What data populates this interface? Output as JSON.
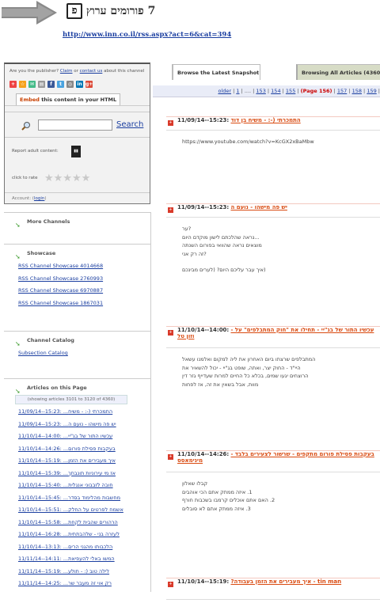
{
  "header": {
    "title": "7 פורומים ערוץ",
    "feed_url": "http://www.inn.co.il/rss.aspx?act=6&cat=394"
  },
  "panel": {
    "publisher_text": "Are you the publisher?",
    "claim": "Claim",
    "or": "or",
    "contact_us": "contact us",
    "about": "about this channel",
    "embed_prefix": "Embed",
    "embed_rest": " this content in your HTML",
    "search_button": "Search",
    "search_value": "",
    "report_label": "Report adult content:",
    "rate_label": "click to rate",
    "account_label": "Account:",
    "login": "login"
  },
  "more_channels": {
    "title": "More Channels"
  },
  "showcase": {
    "title": "Showcase",
    "items": [
      "RSS Channel Showcase 4014668",
      "RSS Channel Showcase 2760993",
      "RSS Channel Showcase 6970887",
      "RSS Channel Showcase 1867031"
    ]
  },
  "catalog": {
    "title": "Channel Catalog",
    "items": [
      "Subsection Catalog"
    ]
  },
  "articles_list": {
    "title": "Articles on this Page",
    "showing": "(showing articles 3101 to 3120 of 4360)",
    "items": [
      "11/09/14--15:23: ...התמכרתי (-: - משיח",
      "11/09/14--15:23: ...יש פה מישהו - נועם ה",
      "11/10/14--14:00: ...עכשיו התור של בג\"יי",
      "11/10/14--14:26: ...בעקבות פסילת פורום",
      "11/10/14--15:19: ...איך מעבירים את הזמן",
      "11/10/14--15:39: ...אז מי עירוניות תונבתך",
      "11/10/14--15:40: ...חובה לזבבוני אנגלית",
      "11/10/14--15:45: ...מחשבות מהלימוד בסדר",
      "11/10/14--15:51: ...אשמח לפרטים על החלק",
      "11/10/14--15:58: ...הרהורים שהבית לקחת",
      "11/10/14--16:28: ...לעזרה בני - שלהבתתית",
      "11/10/14--13:13: ...הלכבותו מהגני הרים",
      "11/11/14--14:11: ...המשו באלי להעפיאת",
      "11/11/14--15:19: ...לילה טוב (: - תולע",
      "11/11/14--14:25: ...רק אוי זה מעבר שר"
    ]
  },
  "tabs": {
    "latest": "Browse the Latest Snapshot",
    "all": "Browsing All Articles (4360 Articles)"
  },
  "pager": {
    "older": "older",
    "first": "1",
    "ellipsis": "....",
    "p153": "153",
    "p154": "154",
    "p155": "155",
    "current": "(Page 156)",
    "p157": "157",
    "p158": "158",
    "p159": "159"
  },
  "articles": [
    {
      "date": "11/09/14--15:23:",
      "title": "התמכרתי (-: - משיח בן דוד",
      "body": [
        "https://www.youtube.com/watch?v=KcGX2xBaMbw"
      ]
    },
    {
      "date": "11/09/14--15:23:",
      "title": "יש פה מישהו - נועם ה",
      "body": [
        "?ער",
        "...נראה שהלכתם לישון מוקדם היום",
        "מוצאים נראה שהוואי בפורום השנתה",
        "?זה רק אני",
        "",
        "(איך עבר עליכם היום? (לערים מבינכם"
      ]
    },
    {
      "date": "11/10/14--14:00:",
      "title": "עכשיו התור של בג\"יי - תחילו את \"חוק המתבלפים\" על - וזון טל",
      "body": [
        "המתבלפים שרצתו ביום האחרון את ליה למקום ואלמנו עשאל",
        "היי\"ד - החוק יצר, ואתה, שופט בג\"יי - יכול להשאיר את",
        "הרוצחים יגעו שמים, בכלא כל החיים למרות שעדייף גזר דין",
        "מוות, אבל בשאין את זה, אז לפחות"
      ]
    },
    {
      "date": "11/10/14--14:26:",
      "title": "בעקבות פסילת פורום מתקפים - שרשור לצעירים בלבד - מינימאסס",
      "body": [
        "קבלו שאלון",
        "1. איזה ממתק אתם הכי אוהבים",
        "2. האם אתם אוכלים קרמבו בשכבות חורף",
        "3. איזה ממתק אתם לא סובלים"
      ]
    },
    {
      "date": "11/10/14--15:19:",
      "title": "?איך מעבירים את הזמן בעבודה - tin man",
      "body": []
    }
  ],
  "colors": {
    "accent_orange": "#d94a10",
    "link_blue": "#1a3ea0",
    "tab_active_bg": "#d7dcc6",
    "bullet_red": "#d93a2a"
  },
  "icons": [
    "arrow-logo-icon",
    "search-icon",
    "adult-report-icon",
    "star-icon",
    "green-arrow-icon",
    "article-bullet-icon",
    "share-icons"
  ]
}
